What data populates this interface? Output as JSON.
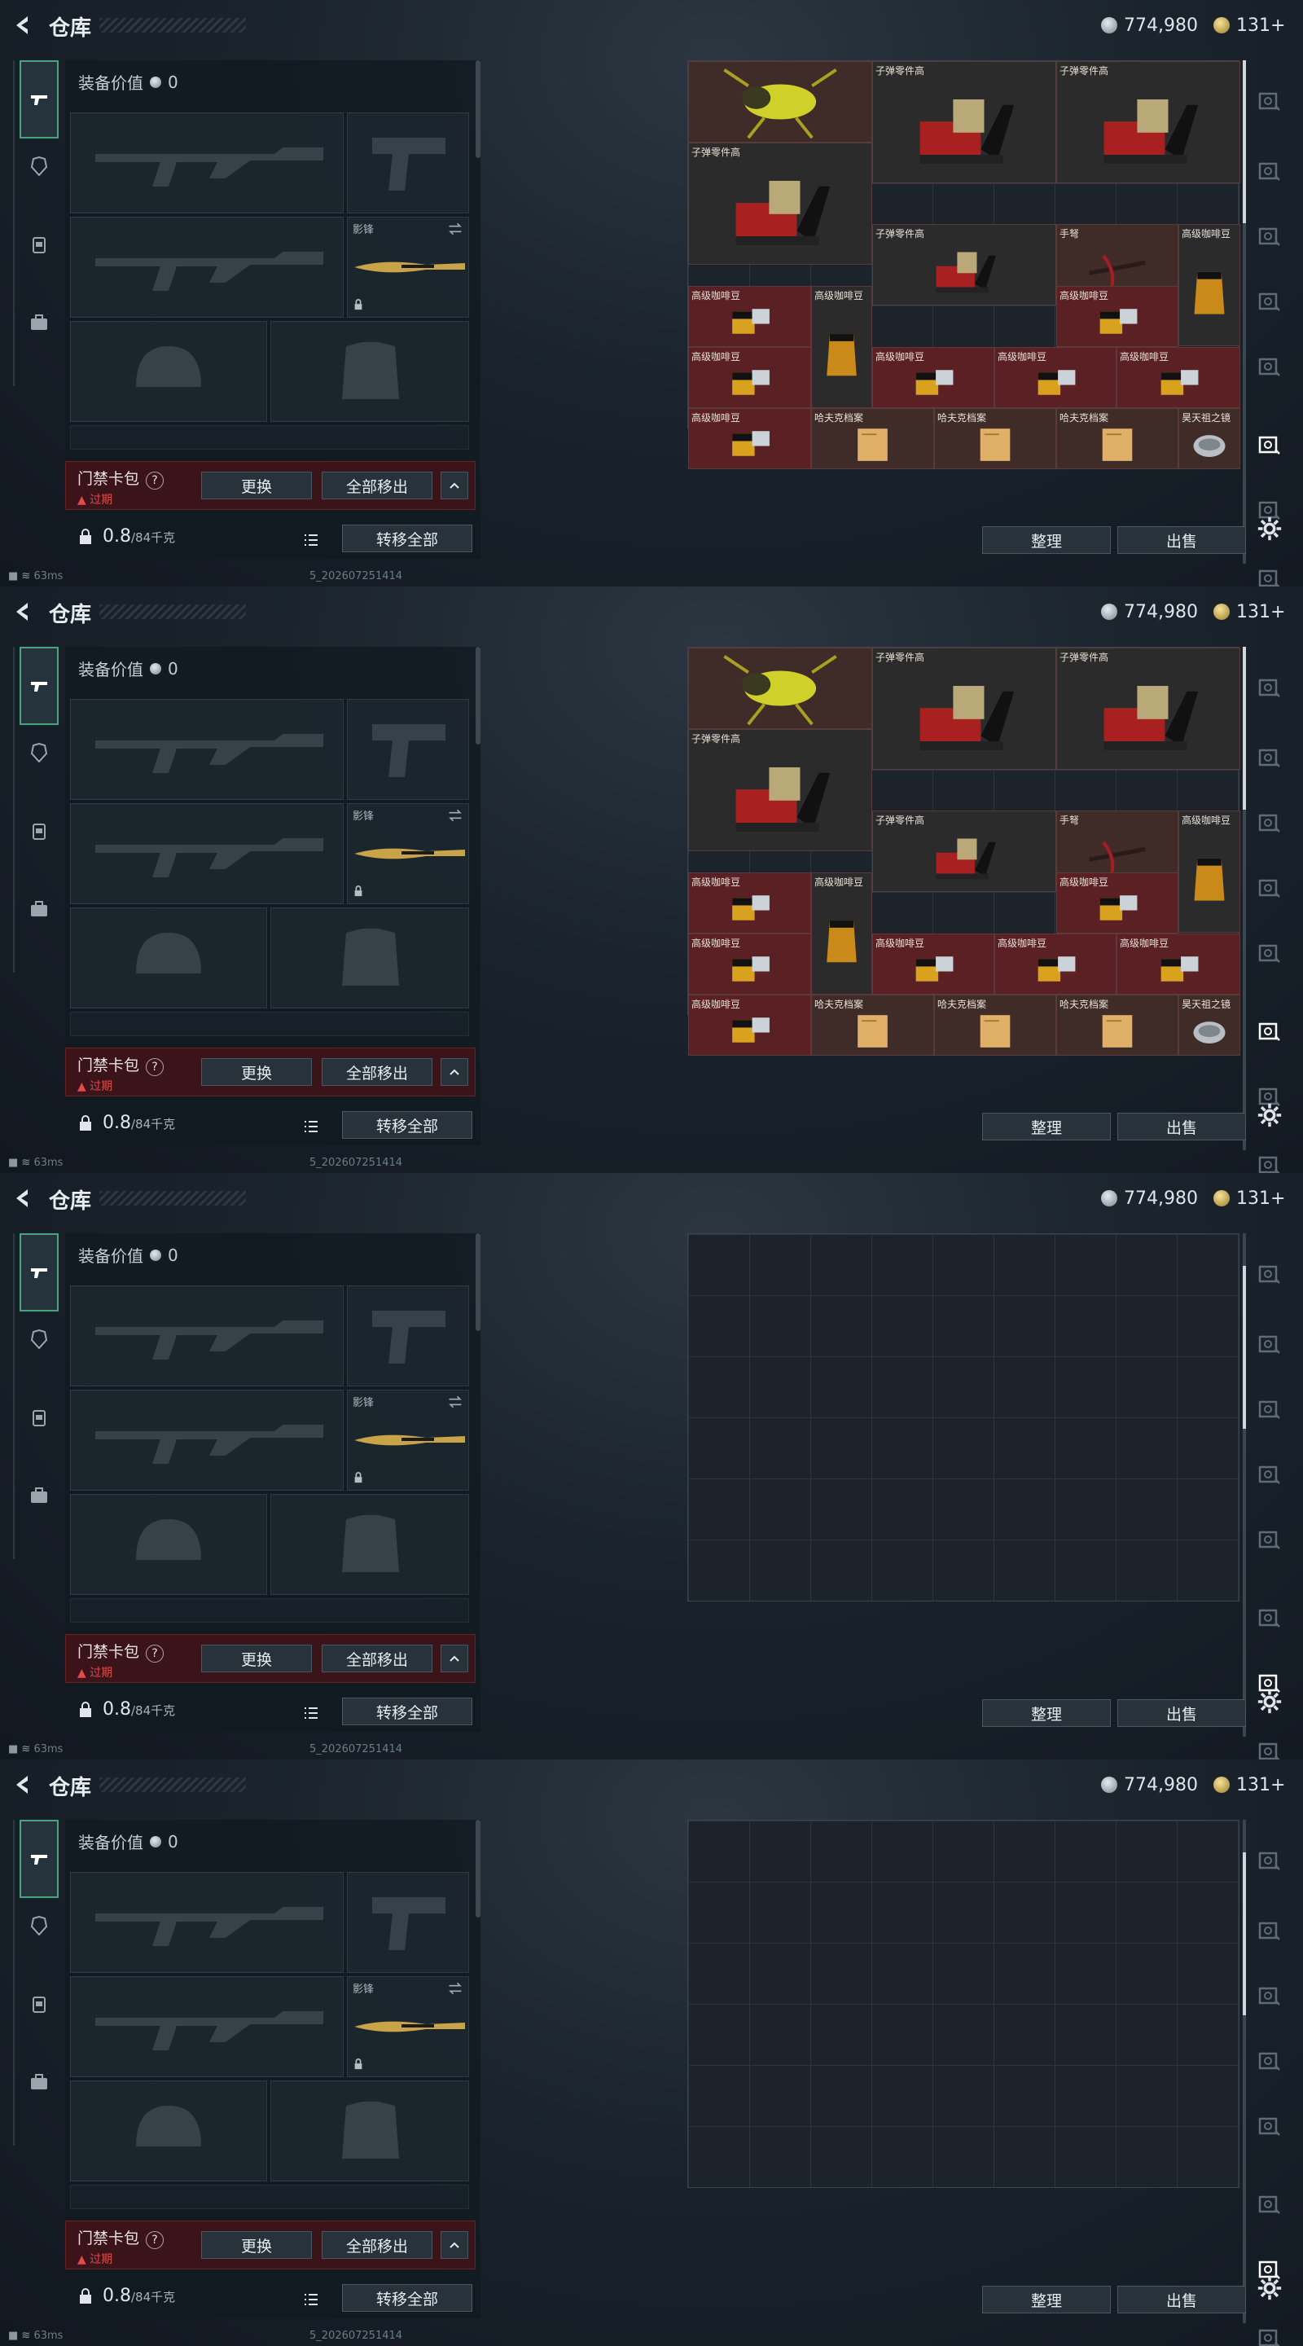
{
  "header": {
    "title": "仓库",
    "currency_silver": "774,980",
    "currency_gold": "131+"
  },
  "status": {
    "ping": "63ms",
    "build": "5_202607251414"
  },
  "loadout": {
    "equip_value_label": "装备价值",
    "equip_value": "0",
    "knife_label": "影锋",
    "keybag_title": "门禁卡包",
    "keybag_status": "过期",
    "replace_btn": "更换",
    "remove_all_btn": "全部移出",
    "weight_value": "0.8",
    "weight_capacity": "/84千克",
    "transfer_all_btn": "转移全部"
  },
  "stash": {
    "sort_btn": "整理",
    "sell_btn": "出售",
    "items": [
      {
        "label": "子弹零件高"
      },
      {
        "label": "子弹零件高"
      },
      {
        "label": "子弹零件高"
      },
      {
        "label": "子弹零件高"
      },
      {
        "label": "手弩"
      },
      {
        "label": "高级咖啡豆"
      },
      {
        "label": "高级咖啡豆"
      },
      {
        "label": "高级咖啡豆"
      },
      {
        "label": "高级咖啡豆"
      },
      {
        "label": "高级咖啡豆"
      },
      {
        "label": "高级咖啡豆"
      },
      {
        "label": "高级咖啡豆"
      },
      {
        "label": "高级咖啡豆"
      },
      {
        "label": "高级咖啡豆"
      },
      {
        "label": "哈夫克档案"
      },
      {
        "label": "哈夫克档案"
      },
      {
        "label": "哈夫克档案"
      },
      {
        "label": "昊天祖之镜"
      }
    ]
  },
  "frames": [
    {
      "stash_state": "items",
      "active_tab": 5
    },
    {
      "stash_state": "items",
      "active_tab": 5
    },
    {
      "stash_state": "empty",
      "active_tab": 6
    },
    {
      "stash_state": "empty",
      "active_tab": 6
    }
  ],
  "colors": {
    "accent_green": "#4aa57a",
    "expired_red": "#e24b4b",
    "keybag_bg": "#3a1418"
  }
}
